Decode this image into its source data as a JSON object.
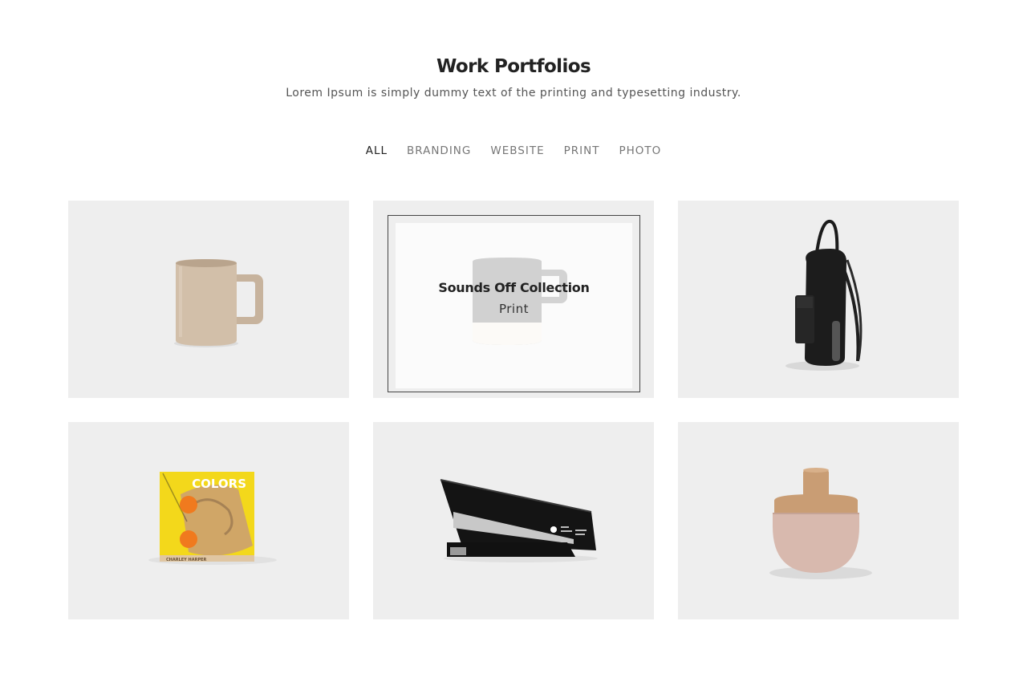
{
  "header": {
    "title": "Work Portfolios",
    "subtitle": "Lorem Ipsum is simply dummy text of the printing and typesetting industry."
  },
  "filters": [
    {
      "label": "ALL",
      "active": true
    },
    {
      "label": "BRANDING",
      "active": false
    },
    {
      "label": "WEBSITE",
      "active": false
    },
    {
      "label": "PRINT",
      "active": false
    },
    {
      "label": "PHOTO",
      "active": false
    }
  ],
  "portfolio": {
    "items": [
      {
        "image": "beige-mug"
      },
      {
        "image": "grey-mug",
        "hover": true,
        "title": "Sounds Off Collection",
        "category": "Print"
      },
      {
        "image": "black-backpack"
      },
      {
        "image": "colors-book",
        "cover_text": "COLORS",
        "author_text": "CHARLEY HARPER"
      },
      {
        "image": "black-stapler"
      },
      {
        "image": "cork-jar"
      }
    ]
  },
  "colors": {
    "card_bg": "#eeeeee",
    "text_dark": "#222222",
    "text_muted": "#777777",
    "book_yellow": "#f3d81b",
    "book_orange": "#f07a1e",
    "jar_pink": "#d8b9ae",
    "cork": "#c99d74"
  }
}
